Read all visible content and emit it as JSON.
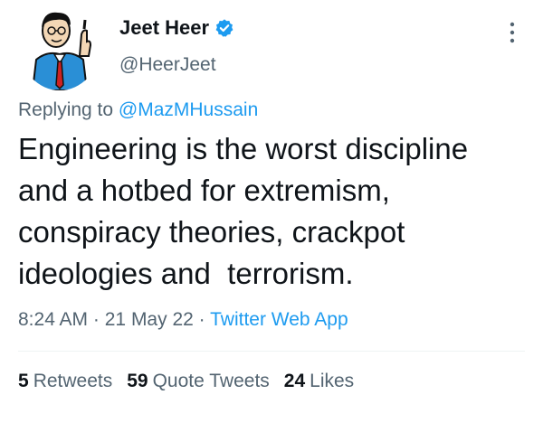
{
  "colors": {
    "text_primary": "#0f1419",
    "text_secondary": "#536471",
    "accent": "#1d9bf0",
    "divider": "#eff3f4"
  },
  "author": {
    "display_name": "Jeet Heer",
    "handle": "@HeerJeet",
    "verified": true,
    "avatar_icon": "caricature-avatar",
    "verified_icon": "verified-badge-icon"
  },
  "reply": {
    "prefix": "Replying to",
    "to_handle": "@MazMHussain"
  },
  "tweet": {
    "text": "Engineering is the worst discipline\nand a hotbed for extremism,\nconspiracy theories, crackpot\nideologies and  terrorism."
  },
  "meta": {
    "time": "8:24 AM",
    "separator": "·",
    "date": "21 May 22",
    "source": "Twitter Web App"
  },
  "stats": [
    {
      "count": "5",
      "label": "Retweets"
    },
    {
      "count": "59",
      "label": "Quote Tweets"
    },
    {
      "count": "24",
      "label": "Likes"
    }
  ],
  "icons": {
    "more": "more-options-icon"
  }
}
